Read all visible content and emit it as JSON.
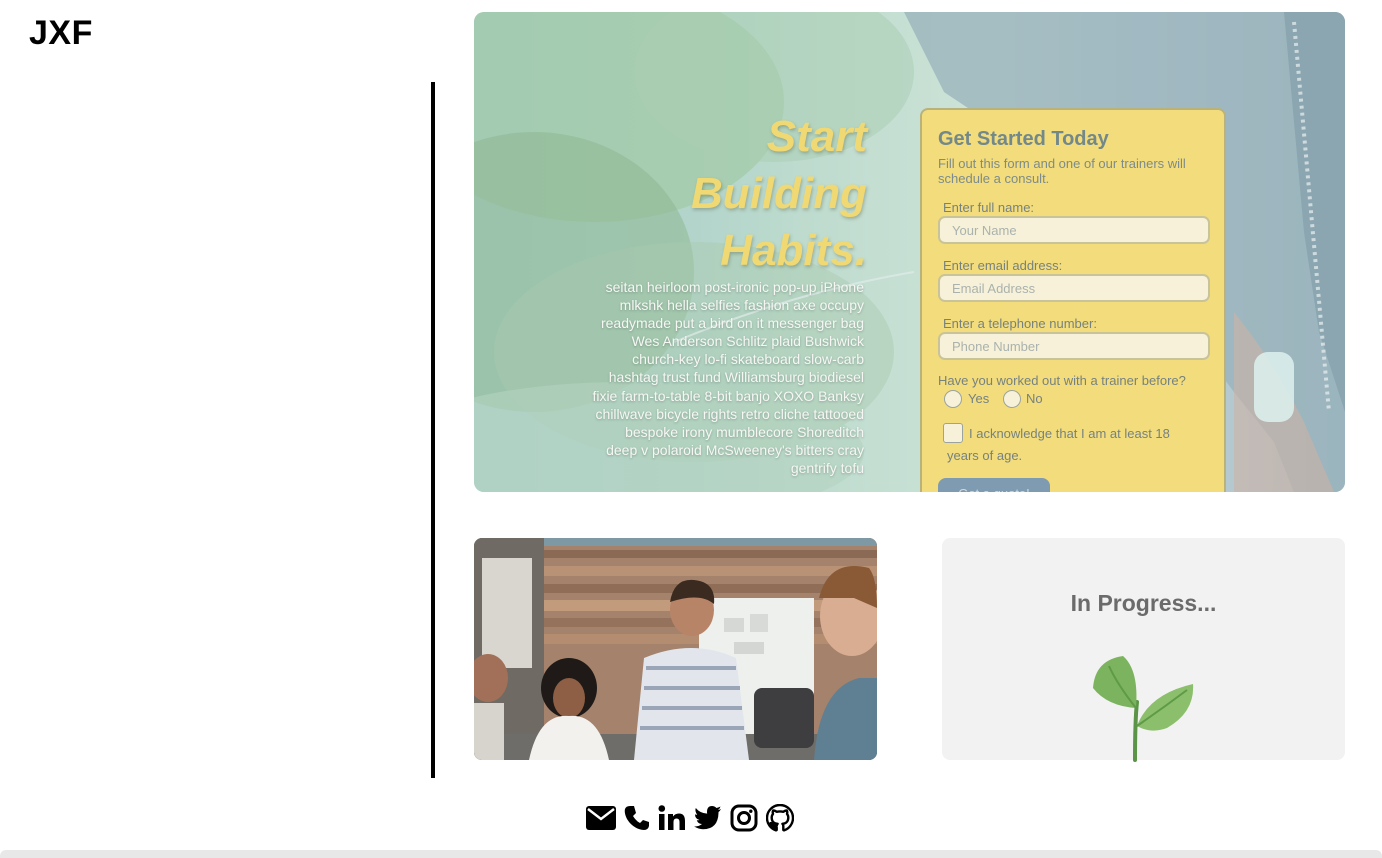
{
  "site": {
    "logo_text": "JXF"
  },
  "hero": {
    "headline": [
      "Start",
      "Building",
      "Habits."
    ],
    "body_text": "seitan heirloom post-ironic pop-up iPhone mlkshk hella selfies fashion axe occupy readymade put a bird on it messenger bag Wes Anderson Schlitz plaid Bushwick church-key lo-fi skateboard slow-carb hashtag trust fund Williamsburg biodiesel fixie farm-to-table 8-bit banjo XOXO Banksy chillwave bicycle rights retro cliche tattooed bespoke irony mumblecore Shoreditch deep v polaroid McSweeney's bitters cray gentrify tofu",
    "form": {
      "title": "Get Started Today",
      "subtitle": "Fill out this form and one of our trainers will schedule a consult.",
      "name_label": "Enter full name:",
      "name_placeholder": "Your Name",
      "email_label": "Enter email address:",
      "email_placeholder": "Email Address",
      "phone_label": "Enter a telephone number:",
      "phone_placeholder": "Phone Number",
      "trainer_question": "Have you worked out with a trainer before?",
      "option_yes": "Yes",
      "option_no": "No",
      "age_ack": "I acknowledge that I am at least 18 years of age.",
      "submit_label": "Get a quote!"
    }
  },
  "progress_card": {
    "title": "In Progress..."
  },
  "socials": [
    "envelope-icon",
    "phone-icon",
    "linkedin-icon",
    "twitter-icon",
    "instagram-icon",
    "github-icon"
  ],
  "colors": {
    "form_background": "#f2dc7c",
    "headline": "#f0d873",
    "submit_button": "#7f9bb1",
    "progress_card": "#f2f2f2",
    "leaf": "#7cb35f"
  }
}
